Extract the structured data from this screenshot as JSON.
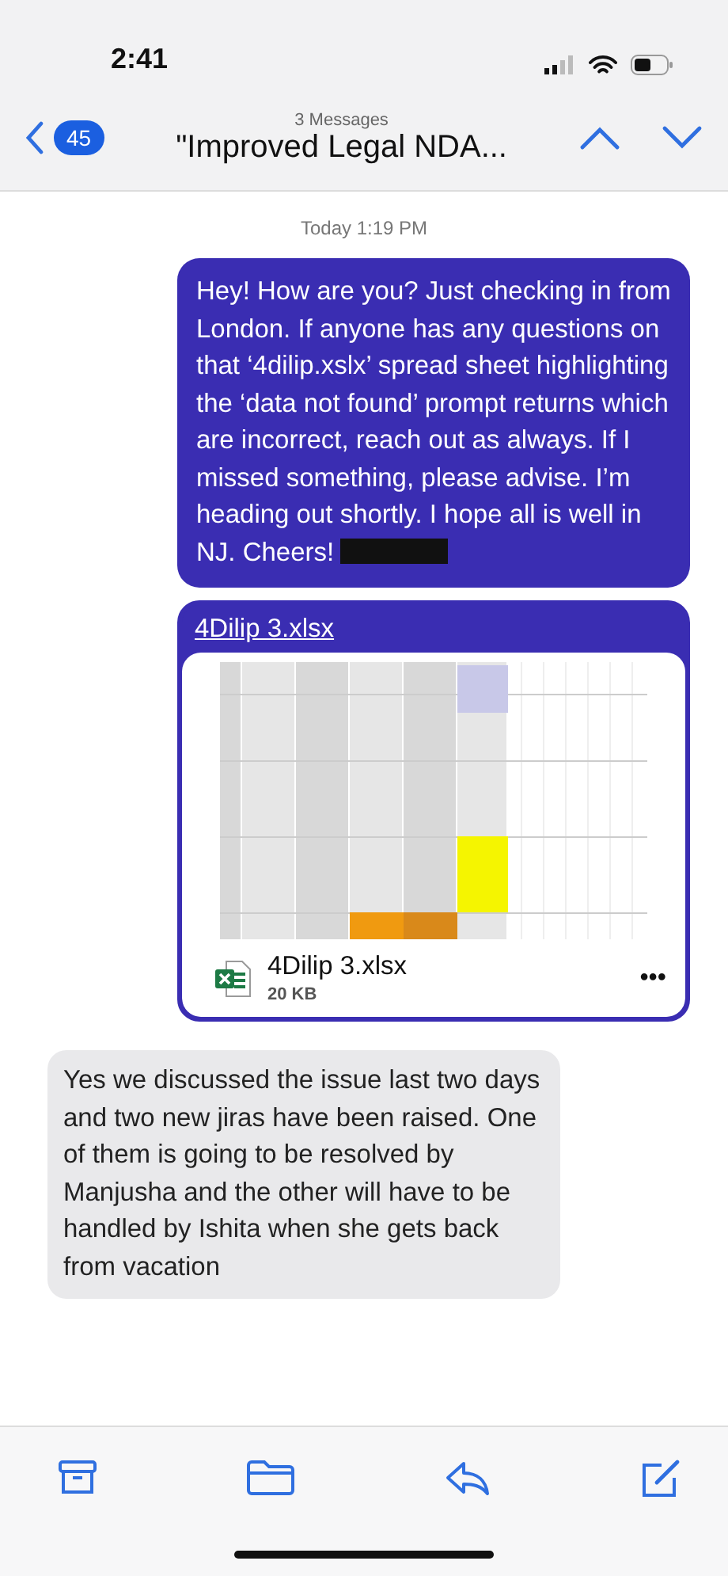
{
  "status_bar": {
    "time": "2:41"
  },
  "nav": {
    "unread_count": "45",
    "message_count": "3 Messages",
    "subject": "\"Improved Legal NDA..."
  },
  "timestamp": "Today 1:19 PM",
  "messages": [
    {
      "kind": "sent",
      "text": "Hey! How are you? Just checking in from London. If anyone has any questions on that ‘4dilip.xslx’ spread sheet highlighting the ‘data not found’ prompt returns which are incorrect, reach out as always. If I missed something, please advise. I’m heading out shortly. I hope all is well in NJ. Cheers!",
      "redacted": true
    },
    {
      "kind": "attachment",
      "link": "4Dilip 3.xlsx",
      "file_name": "4Dilip 3.xlsx",
      "file_size": "20 KB",
      "more": "•••"
    },
    {
      "kind": "received",
      "text": "Yes we discussed the issue last two days and two new jiras have been raised. One of them is going to be resolved by Manjusha and the other will have to be handled by Ishita when she gets back from vacation"
    }
  ]
}
